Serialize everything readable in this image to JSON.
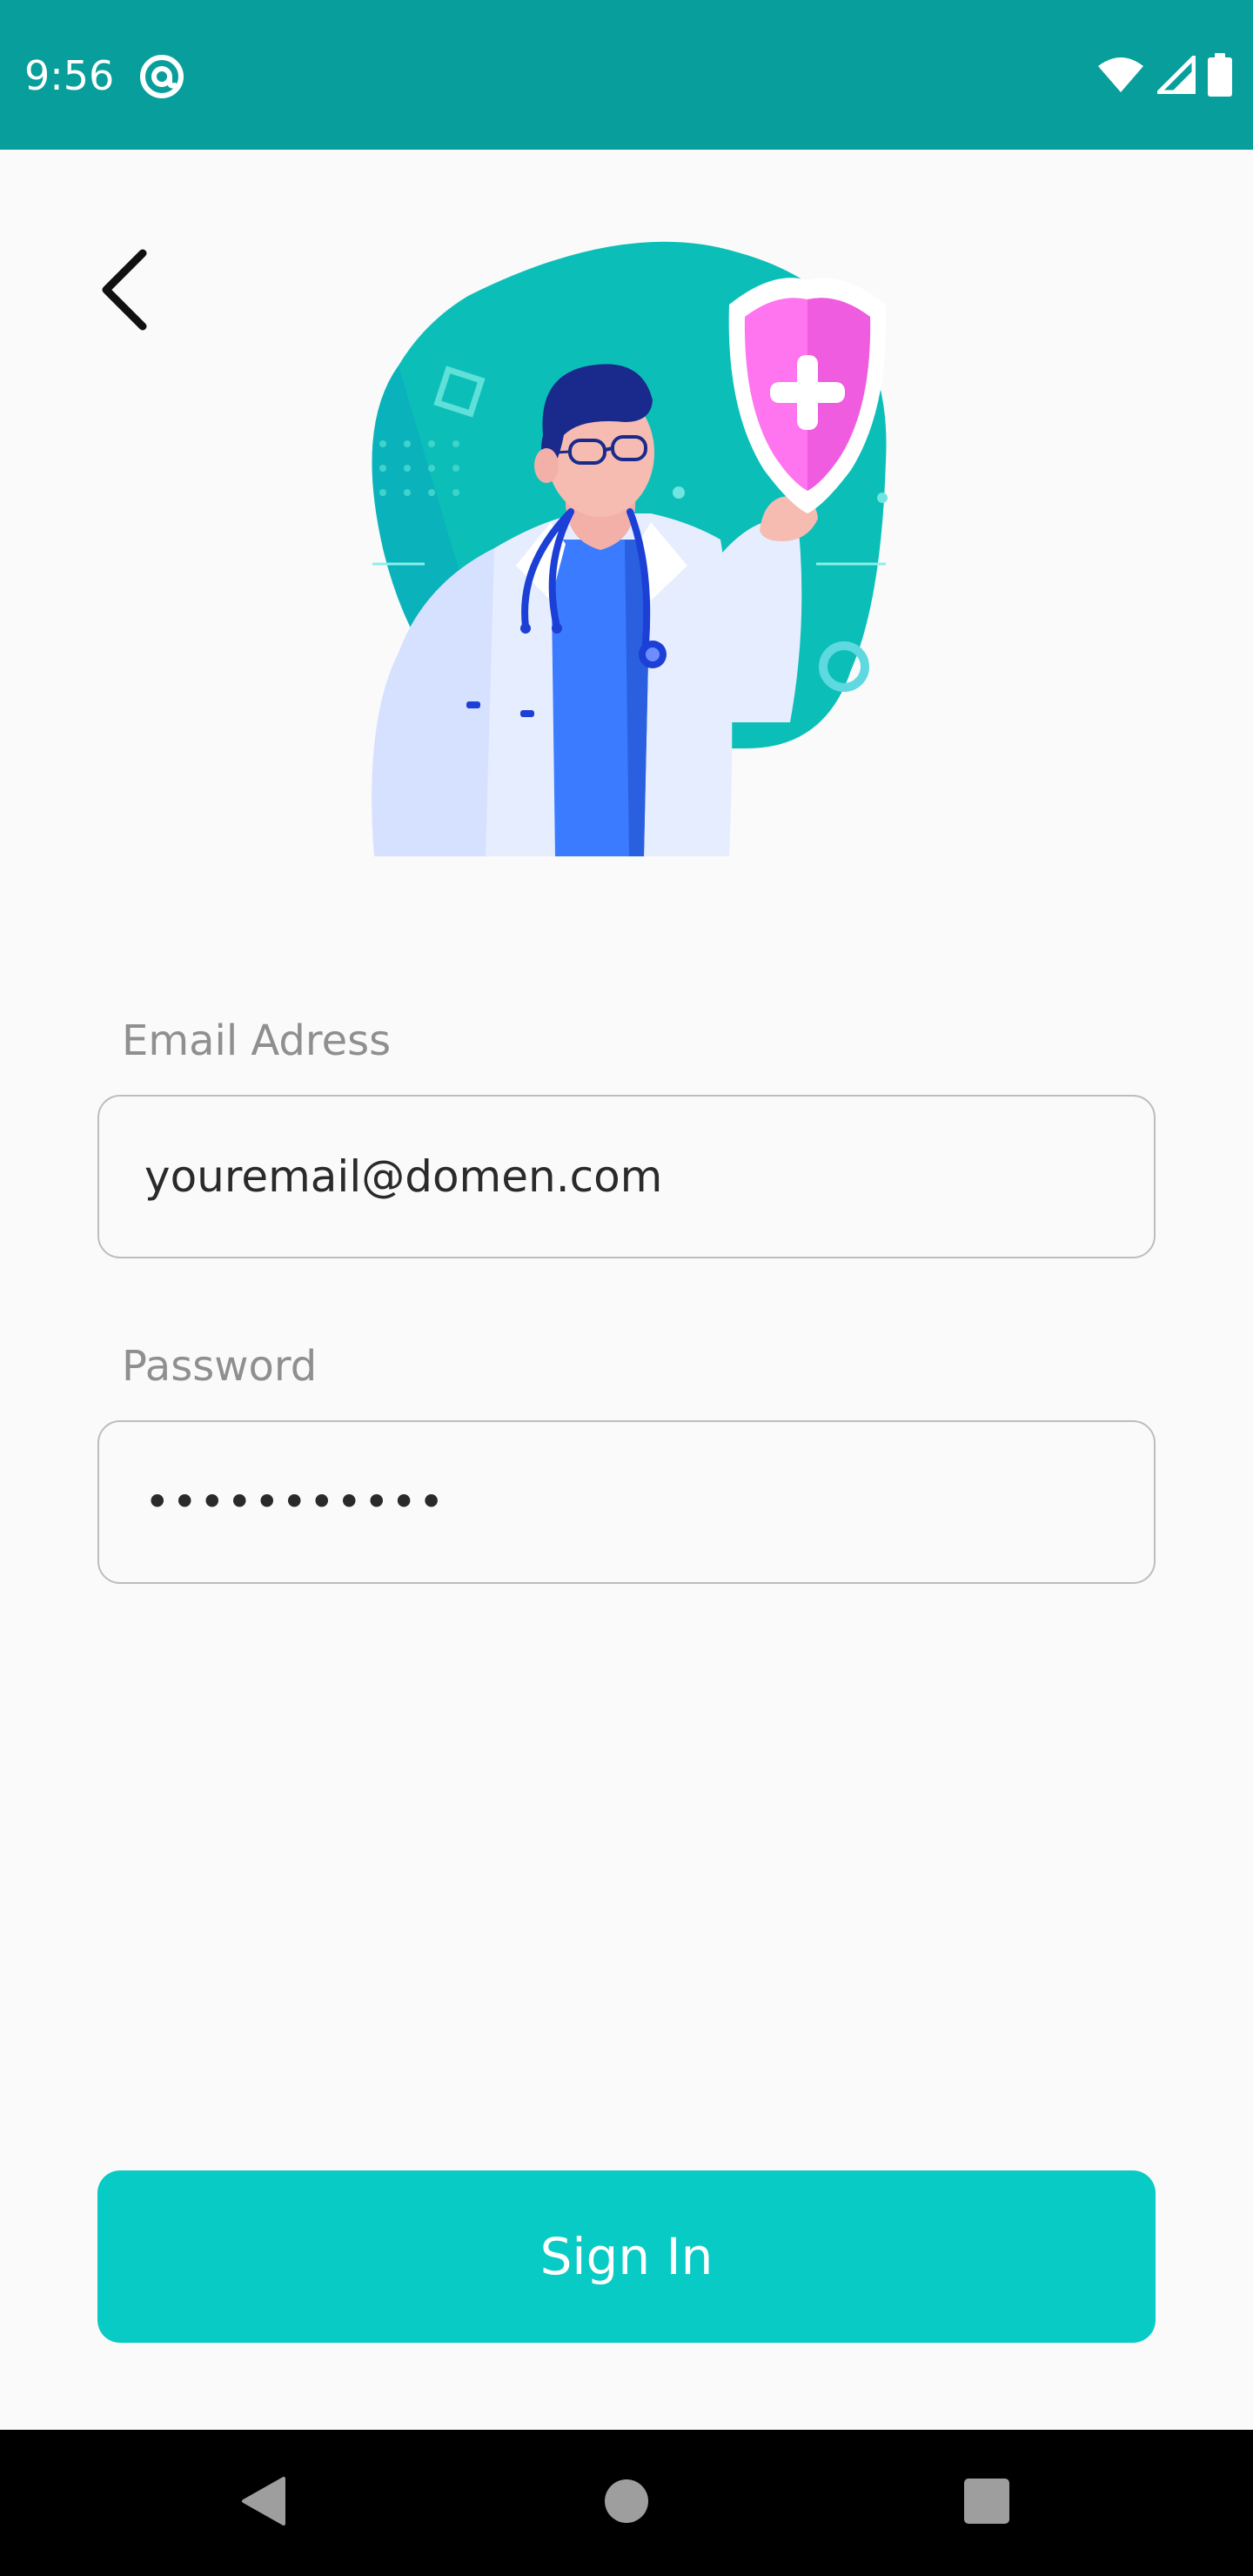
{
  "status_bar": {
    "time": "9:56",
    "background_color": "#089e9b",
    "icons": [
      "at-sign-icon",
      "wifi-icon",
      "signal-icon",
      "battery-icon"
    ]
  },
  "header": {
    "back_icon": "chevron-left-icon"
  },
  "illustration": {
    "subject": "doctor-with-shield-icon",
    "colors": {
      "blob": "#0bbfb8",
      "shield": "#ff74ef",
      "shirt": "#3a7bff"
    }
  },
  "form": {
    "email": {
      "label": "Email Adress",
      "value": "youremail@domen.com"
    },
    "password": {
      "label": "Password",
      "masked_value": "•••••••••••"
    }
  },
  "actions": {
    "sign_in_label": "Sign In",
    "accent_color": "#07cbc4"
  },
  "nav_bar": {
    "icons": [
      "nav-back-icon",
      "nav-home-icon",
      "nav-recents-icon"
    ]
  }
}
